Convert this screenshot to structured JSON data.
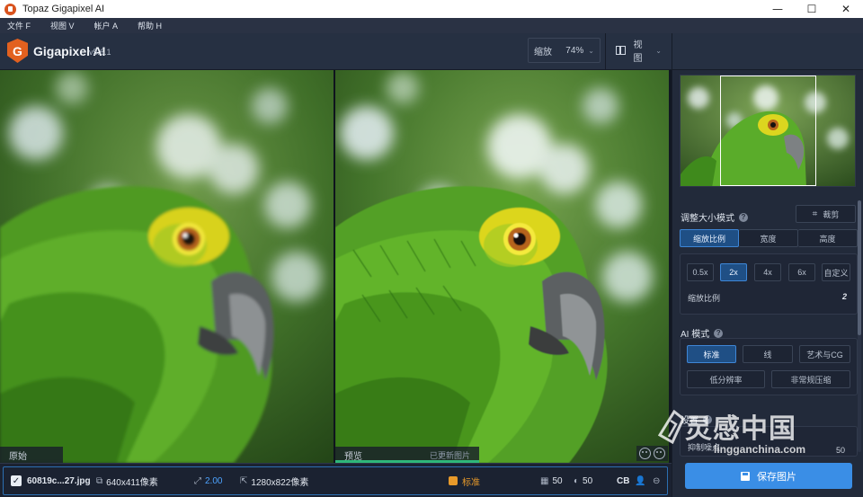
{
  "window": {
    "title": "Topaz Gigapixel AI",
    "controls": {
      "minimize": "—",
      "maximize": "☐",
      "close": "✕"
    }
  },
  "menu": [
    {
      "label": "文件 F"
    },
    {
      "label": "视图 V"
    },
    {
      "label": "帐户 A"
    },
    {
      "label": "帮助 H"
    }
  ],
  "toolbar": {
    "logo_letter": "G",
    "app_name": "Gigapixel AI",
    "version": "v5.6.1",
    "zoom_label": "缩放",
    "zoom_value": "74%",
    "view_label": "视图"
  },
  "viewer": {
    "left_label": "原始",
    "right_label": "预览",
    "right_status": "已更新图片",
    "progress": 1.0
  },
  "statusbar": {
    "filename": "60819c...27.jpg",
    "original_size": "640x411像素",
    "scale": "2.00",
    "output_size": "1280x822像素",
    "mode": "标准",
    "noise_value": "50",
    "blur_value": "50",
    "color_label": "CB"
  },
  "panel": {
    "resize_title": "调整大小模式",
    "crop_label": "裁剪",
    "resize_tabs": [
      {
        "label": "缩放比例",
        "active": true
      },
      {
        "label": "宽度",
        "active": false
      },
      {
        "label": "高度",
        "active": false
      }
    ],
    "scale_options": [
      {
        "label": "0.5x",
        "active": false
      },
      {
        "label": "2x",
        "active": true
      },
      {
        "label": "4x",
        "active": false
      },
      {
        "label": "6x",
        "active": false
      },
      {
        "label": "自定义",
        "active": false
      }
    ],
    "scale_ratio_label": "缩放比例",
    "scale_ratio_value": "2",
    "ai_title": "AI 模式",
    "ai_modes": [
      {
        "label": "标准",
        "active": true
      },
      {
        "label": "线",
        "active": false
      },
      {
        "label": "艺术与CG",
        "active": false
      },
      {
        "label": "低分辨率",
        "active": false
      },
      {
        "label": "非常规压缩",
        "active": false
      }
    ],
    "settings_title": "设置",
    "suppress_noise_label": "抑制噪点",
    "suppress_noise_value": "50",
    "save_label": "保存图片"
  },
  "watermark": {
    "brand_cn": "灵感中国",
    "brand_url": "lingganchina.com"
  },
  "colors": {
    "accent": "#3a8ee6",
    "active_button": "#1f4f85",
    "logo": "#e2611f",
    "mode_badge": "#e89a2a",
    "progress": "#2fb77a"
  }
}
